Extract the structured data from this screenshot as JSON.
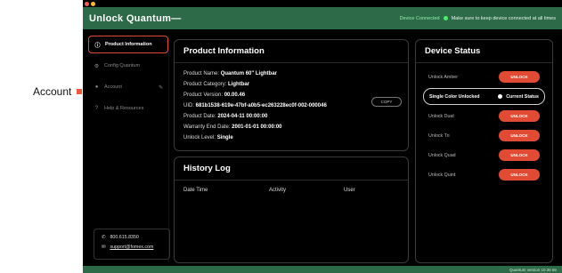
{
  "side_label": "Account",
  "colors": {
    "accent": "#e14b34",
    "header_green": "#2d6a47",
    "connected_dot": "#4eea74"
  },
  "header": {
    "title": "Unlock Quantum—",
    "connected": "Device Connected",
    "hint": "Make sure to keep device connected at all times"
  },
  "sidebar": {
    "items": [
      {
        "label": "Product Information",
        "icon": "info-icon"
      },
      {
        "label": "Config Quantum",
        "icon": "gear-icon"
      },
      {
        "label": "Account",
        "icon": "user-icon"
      },
      {
        "label": "Help & Resources",
        "icon": "help-icon"
      }
    ],
    "phone": "800.615.8350",
    "email": "support@fomex.com"
  },
  "product": {
    "title": "Product Information",
    "name_label": "Product Name:",
    "name": "Quantum 60\" Lightbar",
    "category_label": "Product Category:",
    "category": "Lightbar",
    "version_label": "Product Version:",
    "version": "00.00.46",
    "uid_label": "UID:",
    "uid": "681b1538-619e-47bf-a0b5-ec263228ec0f-002-000046",
    "copy": "COPY",
    "date_label": "Product Date:",
    "date": "2024-04-11 00:00:00",
    "warranty_label": "Warranty End Date:",
    "warranty": "2001-01-01 00:00:00",
    "unlock_label": "Unlock Level:",
    "unlock": "Single"
  },
  "history": {
    "title": "History Log",
    "columns": [
      "Date Time",
      "Activity",
      "User"
    ]
  },
  "device": {
    "title": "Device Status",
    "unlock_btn": "UNLOCK",
    "rows": [
      "Unlock Amber",
      "Single Color Unlocked",
      "Unlock Duat",
      "Unlock Tri",
      "Unlock Quad",
      "Unlock Quint"
    ],
    "current_status": "Current Status"
  },
  "footer": "Quantum version 10.36 8e"
}
